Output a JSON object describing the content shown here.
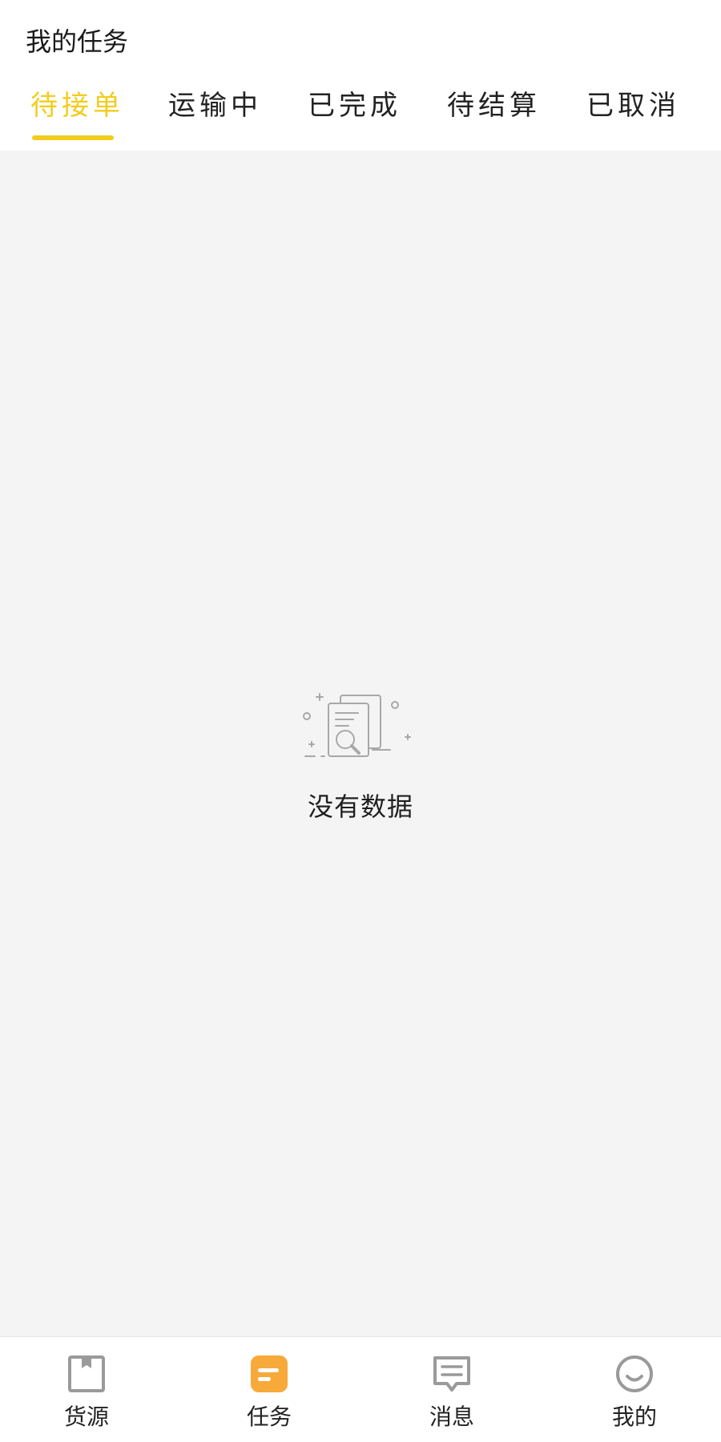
{
  "header": {
    "title": "我的任务"
  },
  "tabs": [
    {
      "label": "待接单",
      "active": true
    },
    {
      "label": "运输中",
      "active": false
    },
    {
      "label": "已完成",
      "active": false
    },
    {
      "label": "待结算",
      "active": false
    },
    {
      "label": "已取消",
      "active": false
    }
  ],
  "empty_state": {
    "message": "没有数据",
    "icon": "document-search-icon"
  },
  "tabbar": {
    "items": [
      {
        "label": "货源",
        "icon": "box-icon",
        "active": false
      },
      {
        "label": "任务",
        "icon": "task-list-icon",
        "active": true
      },
      {
        "label": "消息",
        "icon": "message-icon",
        "active": false
      },
      {
        "label": "我的",
        "icon": "smile-icon",
        "active": false
      }
    ]
  },
  "colors": {
    "accent": "#f2cc1e",
    "active_tab_icon": "#f7a93a",
    "inactive_icon": "#9a9a9a",
    "background": "#f4f4f4"
  }
}
